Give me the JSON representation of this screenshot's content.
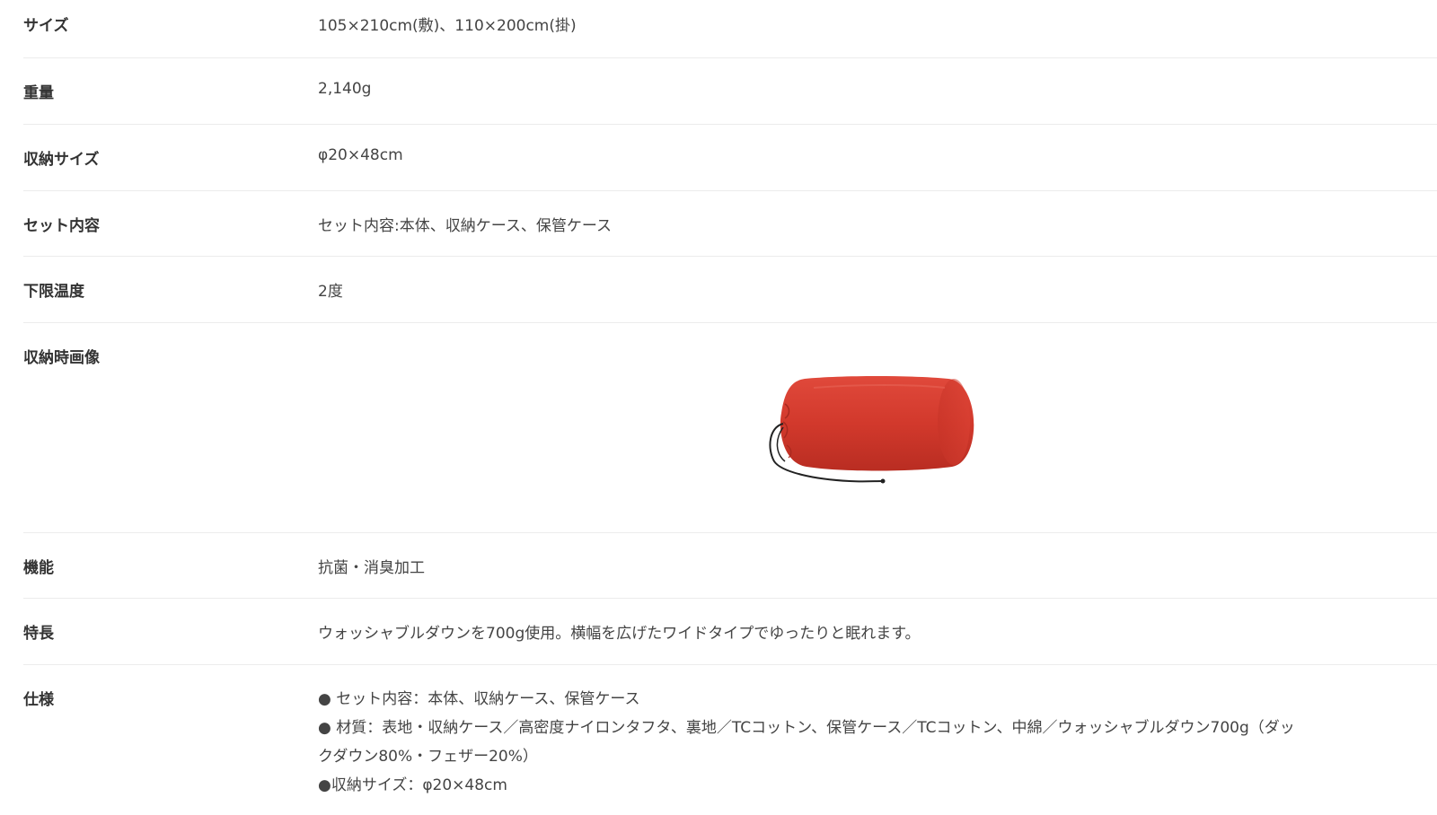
{
  "rows": {
    "size": {
      "label": "サイズ",
      "value": "105×210cm(敷)、110×200cm(掛)"
    },
    "weight": {
      "label": "重量",
      "value": "2,140g"
    },
    "packed_size": {
      "label": "収納サイズ",
      "value": "φ20×48cm"
    },
    "set_contents": {
      "label": "セット内容",
      "value": "セット内容:本体、収納ケース、保管ケース"
    },
    "min_temp": {
      "label": "下限温度",
      "value": "2度"
    },
    "packed_image": {
      "label": "収納時画像",
      "image_icon": "red-stuff-sack-image"
    },
    "function": {
      "label": "機能",
      "value": "抗菌・消臭加工"
    },
    "feature": {
      "label": "特長",
      "value": "ウォッシャブルダウンを700g使用。横幅を広げたワイドタイプでゆったりと眠れます。"
    },
    "spec": {
      "label": "仕様",
      "lines": [
        "● セット内容：本体、収納ケース、保管ケース",
        "● 材質：表地・収納ケース／高密度ナイロンタフタ、裏地／TCコットン、保管ケース／TCコットン、中綿／ウォッシャブルダウン700g（ダッ",
        "クダウン80%・フェザー20%）",
        "●収納サイズ：φ20×48cm"
      ]
    }
  },
  "colors": {
    "text": "#333333",
    "divider": "#ececec",
    "sack": "#d2392c",
    "cord": "#222222"
  }
}
